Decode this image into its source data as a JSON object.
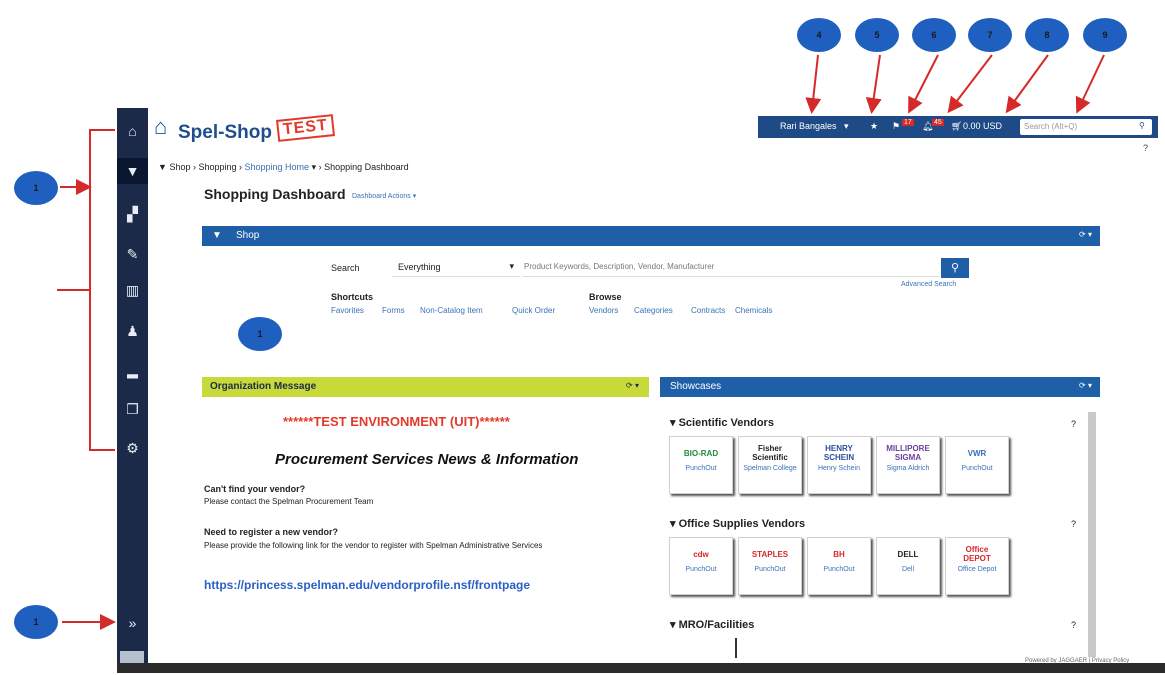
{
  "callouts": [
    "1",
    "1",
    "1",
    "4",
    "5",
    "6",
    "7",
    "8",
    "9"
  ],
  "app": {
    "name": "Spel-Shop",
    "env_stamp": "TEST"
  },
  "topbar": {
    "user": "Rari Bangales",
    "flag_count": "17",
    "bell_count": "45",
    "cart_total": "0.00 USD",
    "search_placeholder": "Search (Alt+Q)",
    "help": "?"
  },
  "breadcrumb": [
    "Shop",
    "Shopping",
    "Shopping Home",
    "Shopping Dashboard"
  ],
  "page": {
    "title": "Shopping Dashboard",
    "actions": "Dashboard Actions"
  },
  "shop_panel": {
    "title": "Shop",
    "search_label": "Search",
    "search_scope": "Everything",
    "search_placeholder": "Product Keywords, Description, Vendor, Manufacturer",
    "advanced": "Advanced Search",
    "shortcuts_label": "Shortcuts",
    "shortcuts": [
      "Favorites",
      "Forms",
      "Non-Catalog Item",
      "Quick Order"
    ],
    "browse_label": "Browse",
    "browse": [
      "Vendors",
      "Categories",
      "Contracts",
      "Chemicals"
    ]
  },
  "org_message": {
    "title": "Organization Message",
    "env_banner": "******TEST ENVIRONMENT (UIT)******",
    "headline": "Procurement Services News & Information",
    "q1": "Can't find your vendor?",
    "a1": "Please contact the Spelman Procurement Team",
    "q2": "Need to register a new vendor?",
    "a2": "Please provide the following link for the vendor to register with Spelman Administrative Services",
    "link": "https://princess.spelman.edu/vendorprofile.nsf/frontpage"
  },
  "showcases": {
    "title": "Showcases",
    "sections": [
      {
        "name": "Scientific Vendors",
        "vendors": [
          {
            "logo": "BIO-RAD",
            "label": "PunchOut",
            "color": "#1f8a3a"
          },
          {
            "logo": "Fisher Scientific",
            "label": "Spelman College",
            "color": "#222222"
          },
          {
            "logo": "HENRY SCHEIN",
            "label": "Henry Schein",
            "color": "#2a4fa0"
          },
          {
            "logo": "MILLIPORE SIGMA",
            "label": "Sigma Aldrich",
            "color": "#6a3fa0"
          },
          {
            "logo": "VWR",
            "label": "PunchOut",
            "color": "#3a6fb5"
          }
        ]
      },
      {
        "name": "Office Supplies Vendors",
        "vendors": [
          {
            "logo": "cdw",
            "label": "PunchOut",
            "color": "#d42a2a"
          },
          {
            "logo": "STAPLES",
            "label": "PunchOut",
            "color": "#d42a2a"
          },
          {
            "logo": "BH",
            "label": "PunchOut",
            "color": "#d42a2a"
          },
          {
            "logo": "DELL",
            "label": "Dell",
            "color": "#222222"
          },
          {
            "logo": "Office DEPOT",
            "label": "Office Depot",
            "color": "#d42a2a"
          }
        ]
      },
      {
        "name": "MRO/Facilities",
        "vendors": []
      }
    ]
  },
  "footer": "Powered by JAGGAER | Privacy Policy"
}
